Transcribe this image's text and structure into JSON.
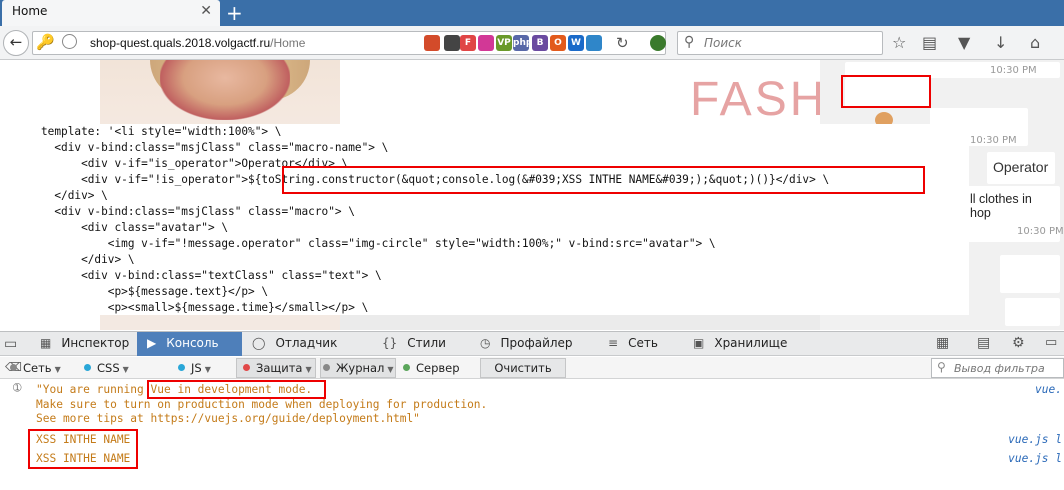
{
  "browser": {
    "tab_title": "Home",
    "tab_close": "✕",
    "new_tab": "+",
    "url_domain": "shop-quest.quals.2018.volgactf.ru",
    "url_path": "/Home",
    "search_placeholder": "Поиск",
    "extensions": [
      {
        "name": "feather",
        "label": "",
        "color": "#d34b2a"
      },
      {
        "name": "flag",
        "label": "",
        "color": "#444444"
      },
      {
        "name": "f-ext",
        "label": "F",
        "color": "#e04545"
      },
      {
        "name": "grid",
        "label": "",
        "color": "#d23896"
      },
      {
        "name": "vpn",
        "label": "VP",
        "color": "#6a9a2a"
      },
      {
        "name": "php",
        "label": "php",
        "color": "#5868a8"
      },
      {
        "name": "b-ext",
        "label": "B",
        "color": "#6a4aa0"
      },
      {
        "name": "o-ext",
        "label": "O",
        "color": "#e25a1c"
      },
      {
        "name": "w-ext",
        "label": "W",
        "color": "#1a6ac9"
      },
      {
        "name": "moon",
        "label": "",
        "color": "#2f86c9"
      }
    ]
  },
  "page": {
    "brand_text": "FASH",
    "chat": {
      "times": [
        "10:30 PM",
        "10:30 PM",
        "10:30 PM"
      ],
      "operator_label": "Operator",
      "message_line1": "ll clothes in",
      "message_line2": "hop"
    },
    "code_lines": [
      "template: '<li style=\"width:100%\"> \\",
      "  <div v-bind:class=\"msjClass\" class=\"macro-name\"> \\",
      "      <div v-if=\"is_operator\">Operator</div> \\",
      "      <div v-if=\"!is_operator\">${toString.constructor(&quot;console.log(&#039;XSS INTHE NAME&#039;);&quot;)()}</div> \\",
      "  </div> \\",
      "  <div v-bind:class=\"msjClass\" class=\"macro\"> \\",
      "      <div class=\"avatar\"> \\",
      "          <img v-if=\"!message.operator\" class=\"img-circle\" style=\"width:100%;\" v-bind:src=\"avatar\"> \\",
      "      </div> \\",
      "      <div v-bind:class=\"textClass\" class=\"text\"> \\",
      "          <p>${message.text}</p> \\",
      "          <p><small>${message.time}</small></p> \\"
    ]
  },
  "devtools": {
    "tabs": [
      {
        "label": "Инспектор",
        "icon": "inspector-icon"
      },
      {
        "label": "Консоль",
        "icon": "console-icon"
      },
      {
        "label": "Отладчик",
        "icon": "debugger-icon"
      },
      {
        "label": "Стили",
        "icon": "style-editor-icon"
      },
      {
        "label": "Профайлер",
        "icon": "profiler-icon"
      },
      {
        "label": "Сеть",
        "icon": "network-icon"
      },
      {
        "label": "Хранилище",
        "icon": "storage-icon"
      }
    ],
    "filters": [
      {
        "label": "Сеть",
        "color": "#888888"
      },
      {
        "label": "CSS",
        "color": "#2aa7d8"
      },
      {
        "label": "JS",
        "color": "#2aa7d8"
      },
      {
        "label": "Защита",
        "color": "#e14848"
      },
      {
        "label": "Журнал",
        "color": "#888888"
      },
      {
        "label": "Сервер",
        "color": "#5aa55a"
      }
    ],
    "clear_label": "Очистить",
    "filter_placeholder": "Вывод фильтра",
    "console": {
      "warn_prefix": "\"You are running ",
      "warn_highlight": "Vue in development mode.",
      "warn_line2": "Make sure to turn on production mode when deploying for production.",
      "warn_line3": "See more tips at https://vuejs.org/guide/deployment.html\"",
      "log1": "XSS INTHE NAME",
      "log2": "XSS INTHE NAME",
      "src1": "vue.",
      "src2": "vue.js l",
      "src3": "vue.js l"
    }
  }
}
